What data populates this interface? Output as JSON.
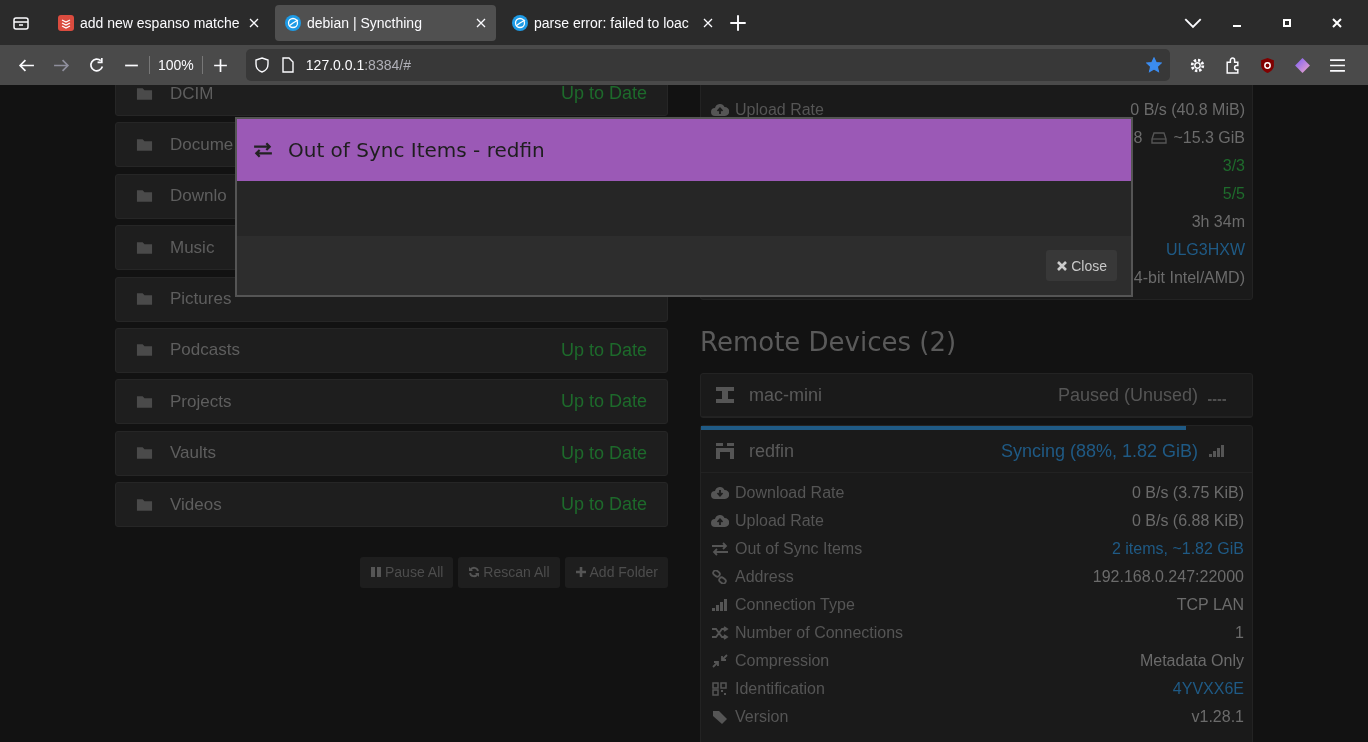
{
  "browser": {
    "tabs": [
      {
        "title": "add new espanso matche",
        "kind": "list",
        "selected": false
      },
      {
        "title": "debian | Syncthing",
        "kind": "sync",
        "selected": true
      },
      {
        "title": "parse error: failed to loac",
        "kind": "sync",
        "selected": false
      }
    ],
    "zoom": "100%",
    "url": {
      "host": "127.0.0.1",
      "path": ":8384/#"
    },
    "bookmarked": true
  },
  "folders": [
    {
      "name": "DCIM",
      "status": "Up to Date"
    },
    {
      "name": "Docume"
    },
    {
      "name": "Downlo"
    },
    {
      "name": "Music"
    },
    {
      "name": "Pictures"
    },
    {
      "name": "Podcasts",
      "status": "Up to Date"
    },
    {
      "name": "Projects",
      "status": "Up to Date"
    },
    {
      "name": "Vaults",
      "status": "Up to Date"
    },
    {
      "name": "Videos",
      "status": "Up to Date"
    }
  ],
  "folder_actions": [
    {
      "label": "Pause All",
      "kind": "pause"
    },
    {
      "label": "Rescan All",
      "kind": "rescan"
    },
    {
      "label": "Add Folder",
      "kind": "add"
    }
  ],
  "this_device": {
    "rows": [
      {
        "kind": "upload",
        "label": "Upload Rate",
        "value": "0 B/s (40.8 MiB)",
        "color": "#6b6b6b"
      },
      {
        "kind": "hidden",
        "value_prefix": "8",
        "value": "~15.3 GiB",
        "color": "#6b6b6b"
      },
      {
        "kind": "hidden",
        "value": "3/3",
        "color": "#1e6b2c"
      },
      {
        "kind": "hidden",
        "value": "5/5",
        "color": "#1e6b2c"
      },
      {
        "kind": "hidden",
        "value": "3h 34m",
        "color": "#6b6b6b"
      },
      {
        "kind": "hidden",
        "value": "ULG3HXW",
        "color": "#1f5a85"
      },
      {
        "kind": "hidden",
        "value": "4-bit Intel/AMD)",
        "color": "#6b6b6b"
      }
    ]
  },
  "remote_devices": {
    "heading": "Remote Devices (2)",
    "devices": [
      {
        "name": "mac-mini",
        "kind": "paused",
        "status": "Paused (Unused)"
      },
      {
        "name": "redfin",
        "kind": "syncing",
        "status": "Syncing (88%, 1.82 GiB)",
        "level": 0.88,
        "rows": [
          {
            "kind": "download",
            "label": "Download Rate",
            "value": "0 B/s (3.75 KiB)",
            "color": "#6b6b6b"
          },
          {
            "kind": "upload",
            "label": "Upload Rate",
            "value": "0 B/s (6.88 KiB)",
            "color": "#6b6b6b"
          },
          {
            "kind": "sync",
            "label": "Out of Sync Items",
            "value": "2 items, ~1.82 GiB",
            "color": "#1f5a85"
          },
          {
            "kind": "link",
            "label": "Address",
            "value": "192.168.0.247:22000",
            "color": "#6b6b6b"
          },
          {
            "kind": "signal",
            "label": "Connection Type",
            "value": "TCP LAN",
            "color": "#6b6b6b"
          },
          {
            "kind": "shuffle",
            "label": "Number of Connections",
            "value": "1",
            "color": "#6b6b6b"
          },
          {
            "kind": "compress",
            "label": "Compression",
            "value": "Metadata Only",
            "color": "#6b6b6b"
          },
          {
            "kind": "qrcode",
            "label": "Identification",
            "value": "4YVXX6E",
            "color": "#1f5a85"
          },
          {
            "kind": "tag",
            "label": "Version",
            "value": "v1.28.1",
            "color": "#6b6b6b"
          }
        ]
      }
    ]
  },
  "modal": {
    "title": "Out of Sync Items - redfin",
    "close": "Close"
  }
}
